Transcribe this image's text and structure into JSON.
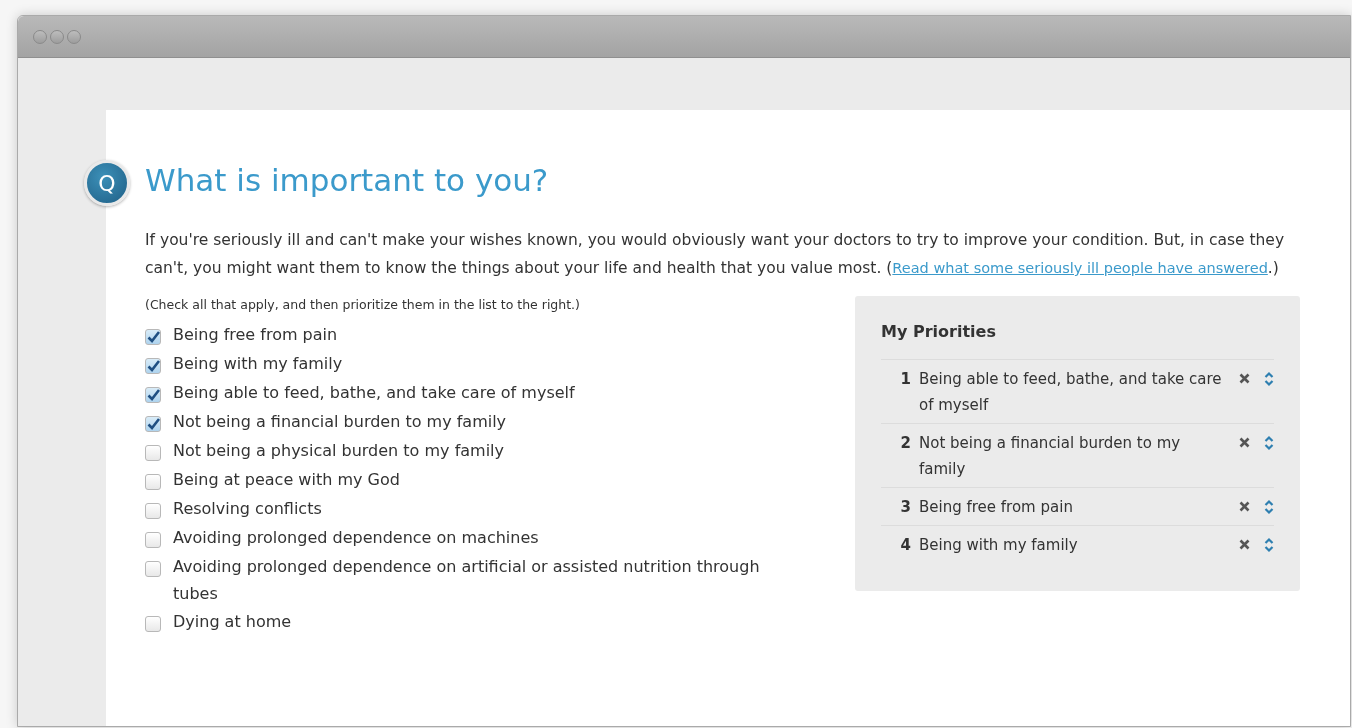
{
  "heading": {
    "badge": "Q",
    "title": "What is important to you?"
  },
  "intro": {
    "text": "If you're seriously ill and can't make your wishes known, you would obviously want your doctors to try to improve your condition. But, in case they can't, you might want them to know the things about your life and health that you value most. (",
    "link": "Read what some seriously ill people have answered",
    "after": ".)"
  },
  "instructions": "(Check all that apply, and then prioritize them in the list to the right.)",
  "options": [
    {
      "label": "Being free from pain",
      "checked": true
    },
    {
      "label": "Being with my family",
      "checked": true
    },
    {
      "label": "Being able to feed, bathe, and take care of myself",
      "checked": true
    },
    {
      "label": "Not being a financial burden to my family",
      "checked": true
    },
    {
      "label": "Not being a physical burden to my family",
      "checked": false
    },
    {
      "label": "Being at peace with my God",
      "checked": false
    },
    {
      "label": "Resolving conflicts",
      "checked": false
    },
    {
      "label": "Avoiding prolonged dependence on machines",
      "checked": false
    },
    {
      "label": "Avoiding prolonged dependence on artificial or assisted nutrition through tubes",
      "checked": false
    },
    {
      "label": "Dying at home",
      "checked": false
    }
  ],
  "priorities": {
    "title": "My Priorities",
    "items": [
      {
        "rank": "1",
        "label": "Being able to feed, bathe, and take care of myself"
      },
      {
        "rank": "2",
        "label": "Not being a financial burden to my family"
      },
      {
        "rank": "3",
        "label": "Being free from pain"
      },
      {
        "rank": "4",
        "label": "Being with my family"
      }
    ]
  }
}
